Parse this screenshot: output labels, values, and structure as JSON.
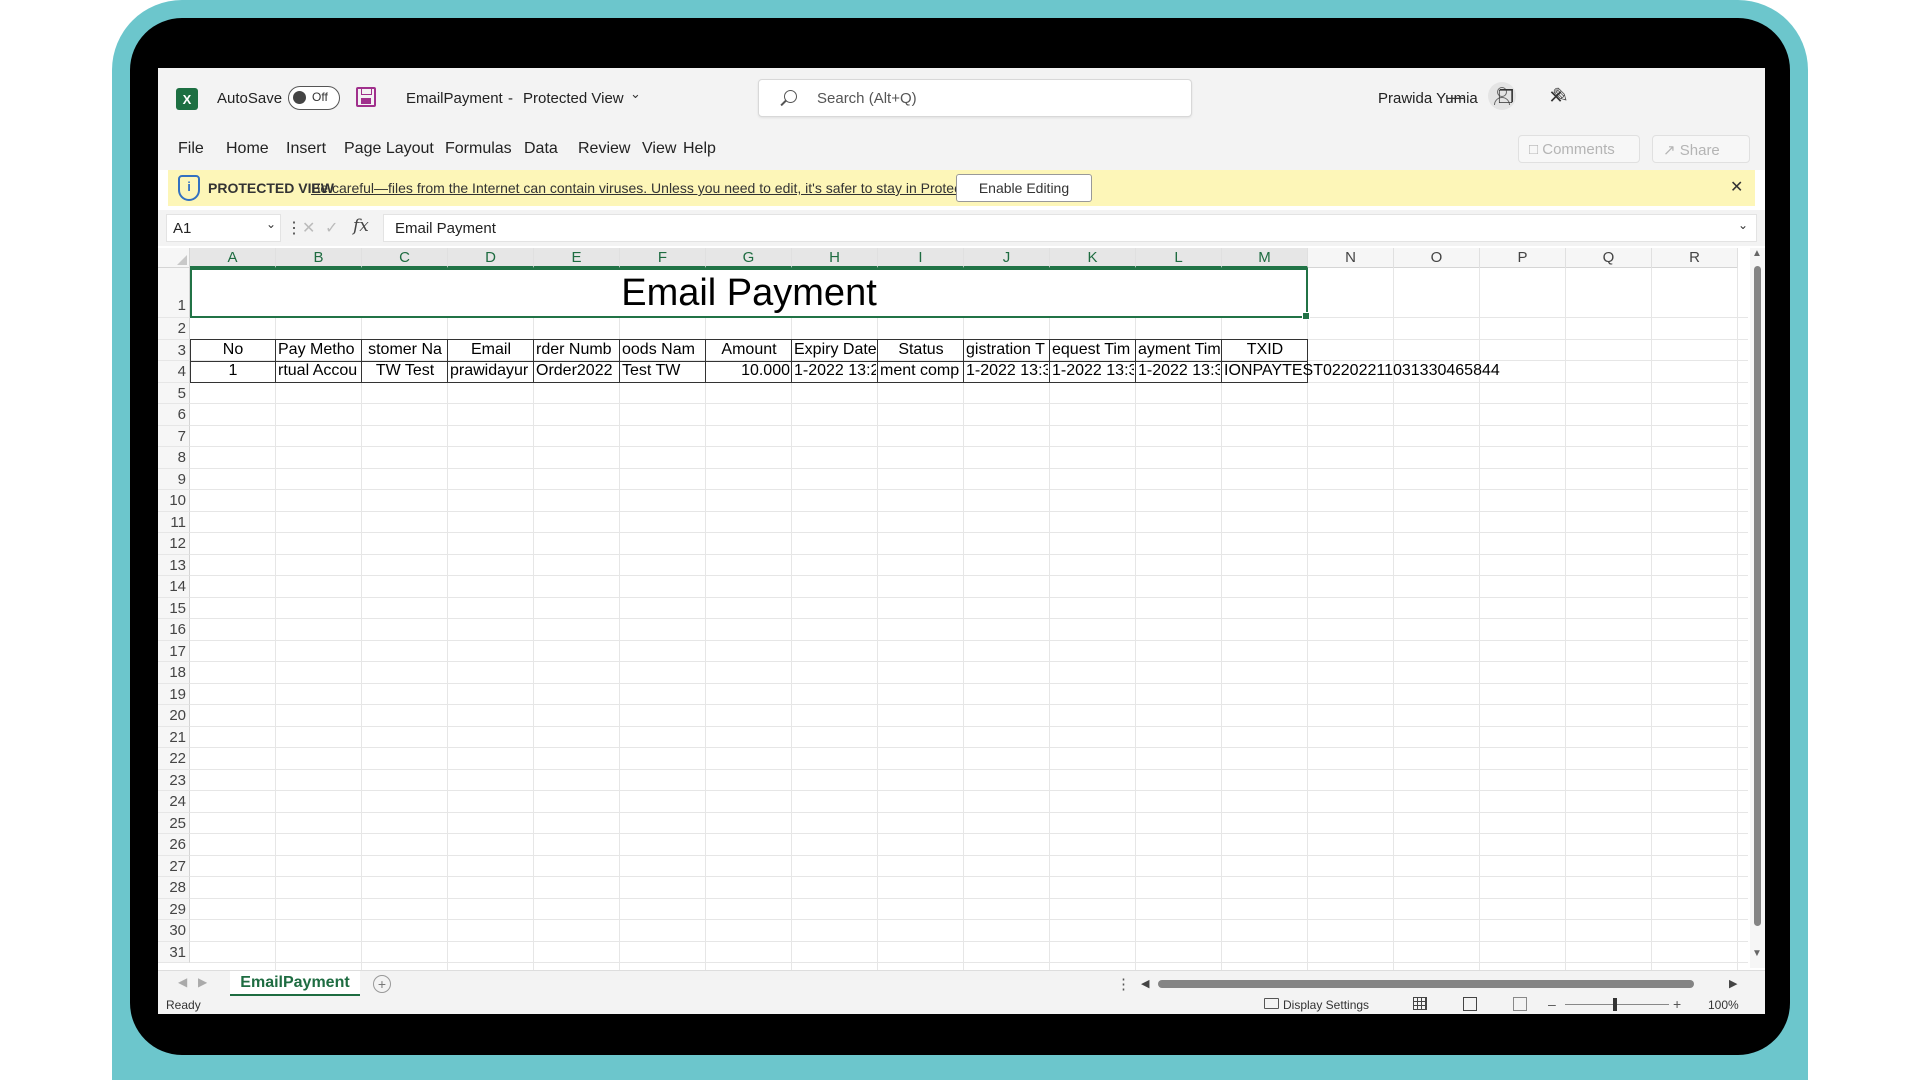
{
  "titlebar": {
    "app_icon": "excel-icon",
    "autosave_label": "AutoSave",
    "autosave_state": "Off",
    "doc_name": "EmailPayment",
    "separator": "-",
    "doc_mode": "Protected View",
    "search_placeholder": "Search (Alt+Q)",
    "user_name": "Prawida Yumia"
  },
  "menu": {
    "items": [
      "File",
      "Home",
      "Insert",
      "Page Layout",
      "Formulas",
      "Data",
      "Review",
      "View",
      "Help"
    ],
    "comments_label": "Comments",
    "share_label": "Share"
  },
  "protected_view": {
    "label": "PROTECTED VIEW",
    "message": "Be careful—files from the Internet can contain viruses. Unless you need to edit, it's safer to stay in Protected View.",
    "enable_button": "Enable Editing"
  },
  "formula_bar": {
    "name_box": "A1",
    "fx_label": "fx",
    "value": "Email Payment"
  },
  "sheet": {
    "columns": [
      "A",
      "B",
      "C",
      "D",
      "E",
      "F",
      "G",
      "H",
      "I",
      "J",
      "K",
      "L",
      "M",
      "N",
      "O",
      "P",
      "Q",
      "R"
    ],
    "selected_columns": [
      "A",
      "B",
      "C",
      "D",
      "E",
      "F",
      "G",
      "H",
      "I",
      "J",
      "K",
      "L",
      "M"
    ],
    "rows": [
      "1",
      "2",
      "3",
      "4",
      "5",
      "6",
      "7",
      "8",
      "9",
      "10",
      "11",
      "12",
      "13",
      "14",
      "15",
      "16",
      "17",
      "18",
      "19",
      "20",
      "21",
      "22",
      "23",
      "24",
      "25",
      "26",
      "27",
      "28",
      "29",
      "30",
      "31"
    ],
    "title": "Email Payment",
    "header_cells": [
      "No",
      "Pay Metho",
      "stomer Na",
      "Email",
      "rder Numb",
      "oods Nam",
      "Amount",
      "Expiry Date",
      "Status",
      "gistration T",
      "equest Tim",
      "ayment Tim",
      "TXID"
    ],
    "data_cells": [
      "1",
      "rtual Accou",
      "TW Test",
      "prawidayur",
      "Order2022",
      "Test TW",
      "10.000",
      "1-2022 13:2",
      "ment comp",
      "1-2022 13:3",
      "1-2022 13:3",
      "1-2022 13:3",
      "IONPAYTEST02202211031330465844"
    ]
  },
  "tabs": {
    "sheet_name": "EmailPayment",
    "add_label": "+"
  },
  "status": {
    "ready": "Ready",
    "display_settings": "Display Settings",
    "zoom_minus": "–",
    "zoom_plus": "+",
    "zoom": "100%"
  }
}
